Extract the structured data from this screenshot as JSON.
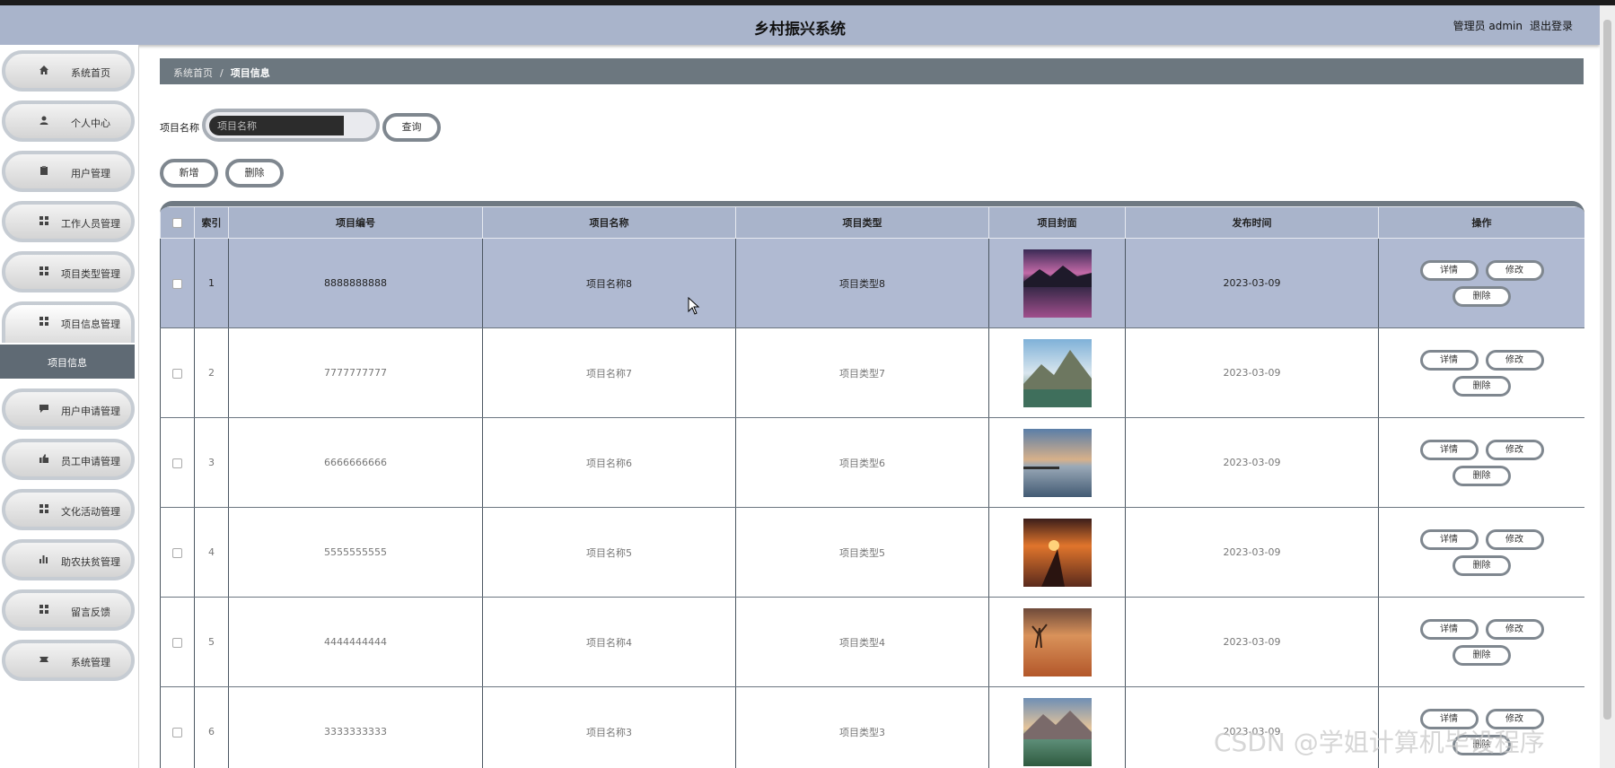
{
  "header": {
    "title": "乡村振兴系统",
    "user": "管理员 admin",
    "logout": "退出登录"
  },
  "sidebar": {
    "items": [
      {
        "label": "系统首页",
        "icon": "home-icon"
      },
      {
        "label": "个人中心",
        "icon": "user-icon"
      },
      {
        "label": "用户管理",
        "icon": "clipboard-icon"
      },
      {
        "label": "工作人员管理",
        "icon": "grid-icon"
      },
      {
        "label": "项目类型管理",
        "icon": "grid-icon"
      },
      {
        "label": "项目信息管理",
        "icon": "grid-icon"
      },
      {
        "label": "用户申请管理",
        "icon": "chat-icon"
      },
      {
        "label": "员工申请管理",
        "icon": "thumb-icon"
      },
      {
        "label": "文化活动管理",
        "icon": "grid-icon"
      },
      {
        "label": "助农扶贫管理",
        "icon": "bar-chart-icon"
      },
      {
        "label": "留言反馈",
        "icon": "grid-icon"
      },
      {
        "label": "系统管理",
        "icon": "ticket-icon"
      }
    ],
    "submenu": "项目信息"
  },
  "breadcrumb": {
    "home": "系统首页",
    "sep": "/",
    "current": "项目信息"
  },
  "search": {
    "label": "项目名称",
    "placeholder": "项目名称",
    "button": "查询"
  },
  "actions": {
    "add": "新增",
    "delete": "删除"
  },
  "table": {
    "headers": [
      "索引",
      "项目编号",
      "项目名称",
      "项目类型",
      "项目封面",
      "发布时间",
      "操作"
    ],
    "ops": {
      "detail": "详情",
      "edit": "修改",
      "delete": "删除"
    },
    "rows": [
      {
        "index": "1",
        "code": "8888888888",
        "name": "项目名称8",
        "type": "项目类型8",
        "date": "2023-03-09"
      },
      {
        "index": "2",
        "code": "7777777777",
        "name": "项目名称7",
        "type": "项目类型7",
        "date": "2023-03-09"
      },
      {
        "index": "3",
        "code": "6666666666",
        "name": "项目名称6",
        "type": "项目类型6",
        "date": "2023-03-09"
      },
      {
        "index": "4",
        "code": "5555555555",
        "name": "项目名称5",
        "type": "项目类型5",
        "date": "2023-03-09"
      },
      {
        "index": "5",
        "code": "4444444444",
        "name": "项目名称4",
        "type": "项目类型4",
        "date": "2023-03-09"
      },
      {
        "index": "6",
        "code": "3333333333",
        "name": "项目名称3",
        "type": "项目类型3",
        "date": "2023-03-09"
      }
    ]
  },
  "watermark": "CSDN @学姐计算机毕设程序"
}
